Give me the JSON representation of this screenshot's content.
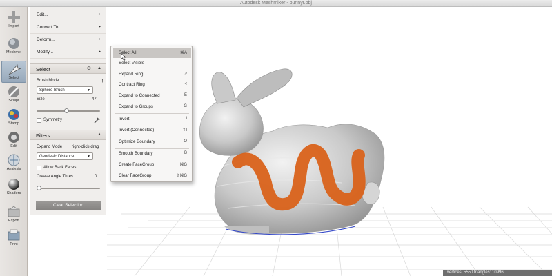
{
  "window": {
    "title": "Autodesk Meshmixer - bunnyr.obj"
  },
  "tools": [
    {
      "id": "import",
      "label": "Import",
      "icon": "plus-icon"
    },
    {
      "id": "meshmix",
      "label": "Meshmix",
      "icon": "meshmix-icon"
    },
    {
      "id": "select",
      "label": "Select",
      "icon": "select-arrow-icon",
      "active": true
    },
    {
      "id": "sculpt",
      "label": "Sculpt",
      "icon": "brush-icon"
    },
    {
      "id": "stamp",
      "label": "Stamp",
      "icon": "stamp-icon"
    },
    {
      "id": "edit",
      "label": "Edit",
      "icon": "edit-icon"
    },
    {
      "id": "analysis",
      "label": "Analysis",
      "icon": "analysis-icon"
    },
    {
      "id": "shaders",
      "label": "Shaders",
      "icon": "shader-sphere-icon"
    },
    {
      "id": "export",
      "label": "Export",
      "icon": "export-icon"
    },
    {
      "id": "print",
      "label": "Print",
      "icon": "printer-icon"
    }
  ],
  "panel": {
    "menu": [
      {
        "label": "Edit...",
        "arrow": "▸"
      },
      {
        "label": "Convert To...",
        "arrow": "▸"
      },
      {
        "label": "Deform...",
        "arrow": "▸"
      },
      {
        "label": "Modify...",
        "arrow": "▸"
      }
    ],
    "select_section": {
      "title": "Select",
      "brush_mode_label": "Brush Mode",
      "brush_mode_value": "Sphere Brush",
      "size_label": "Size",
      "size_value": "47",
      "size_fraction": 0.47,
      "symmetry_label": "Symmetry"
    },
    "filters_section": {
      "title": "Filters",
      "expand_mode_label": "Expand Mode",
      "expand_mode_hint": "right-click-drag",
      "expand_mode_value": "Geodesic Distance",
      "allow_back_faces_label": "Allow Back Faces",
      "crease_angle_label": "Crease Angle Thres",
      "crease_angle_value": "0",
      "crease_fraction": 0.0
    },
    "clear_selection_label": "Clear Selection"
  },
  "context_menu": {
    "items": [
      {
        "label": "Select All",
        "key": "⌘A",
        "highlight": true
      },
      {
        "label": "Select Visible",
        "key": ""
      },
      {
        "label": "Expand Ring",
        "key": ">"
      },
      {
        "label": "Contract Ring",
        "key": "<"
      },
      {
        "label": "Expand to Connected",
        "key": "E"
      },
      {
        "label": "Expand to Groups",
        "key": "G"
      },
      {
        "label": "Invert",
        "key": "I"
      },
      {
        "label": "Invert (Connected)",
        "key": "⇧I"
      },
      {
        "label": "Optimize Boundary",
        "key": "O"
      },
      {
        "label": "Smooth Boundary",
        "key": "B"
      },
      {
        "label": "Create FaceGroup",
        "key": "⌘G"
      },
      {
        "label": "Clear FaceGroup",
        "key": "⇧⌘G"
      }
    ]
  },
  "status": {
    "text": "vertices: 5550 triangles: 10996"
  },
  "colors": {
    "selection": "#d9621a",
    "mesh": "#c8c8c8",
    "panel": "#f0eeec"
  }
}
